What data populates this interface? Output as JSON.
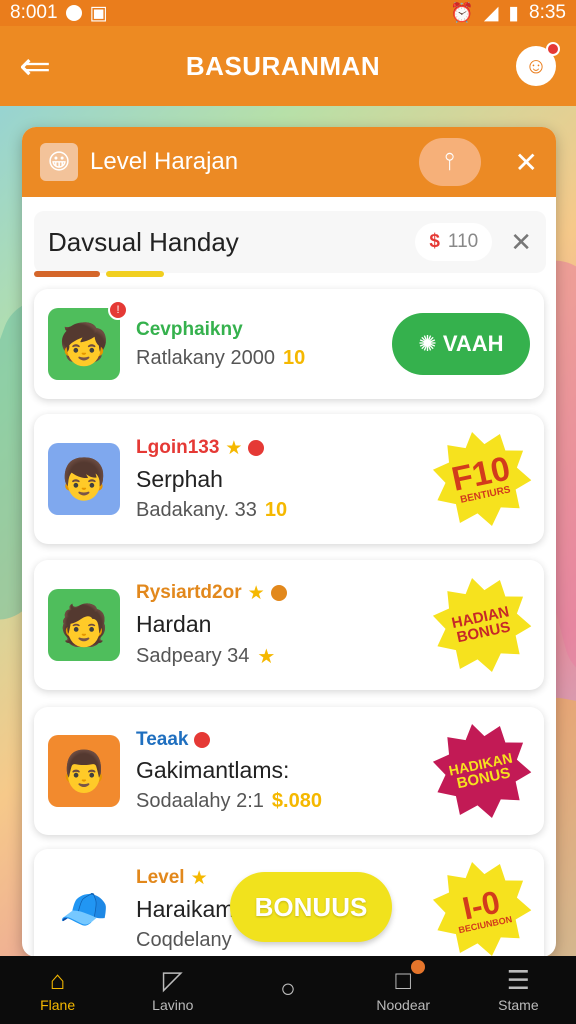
{
  "status": {
    "time_left": "8:001",
    "time_right": "8:35"
  },
  "appbar": {
    "title": "BASURANMAN"
  },
  "modal": {
    "title": "Level Harajan",
    "sub_title": "Davsual Handay",
    "pill_currency": "$",
    "pill_value": "110"
  },
  "cards": [
    {
      "tag": "Cevphaikny",
      "tag_color": "#35b14d",
      "name": "",
      "meta": "Ratlakany 2000",
      "coin": "10",
      "action": "VAAH",
      "burst": ""
    },
    {
      "tag": "Lgoin133",
      "tag_color": "#e53935",
      "name": "Serphah",
      "meta": "Badakany. 33",
      "coin": "10",
      "burst_big": "F10",
      "burst_small": "BENTIURS"
    },
    {
      "tag": "Rysiartd2or",
      "tag_color": "#e2881c",
      "name": "Hardan",
      "meta": "Sadpeary 34",
      "burst_big": "HADIAN",
      "burst_small": "BONUS"
    },
    {
      "tag": "Teaak",
      "tag_color": "#1f6fbf",
      "name": "Gakimantlams:",
      "meta": "Sodaalahy 2:1",
      "coin": "$.080",
      "burst_big": "HADIKAN",
      "burst_small": "BONUS"
    },
    {
      "tag": "Level",
      "tag_color": "#e2881c",
      "name": "Haraikam",
      "meta": "Coqdelany",
      "burst_big": "I-0",
      "burst_small": "BECIUNBON"
    }
  ],
  "bonus_button": "BONUUS",
  "nav": [
    {
      "label": "Flane",
      "icon": "home-icon"
    },
    {
      "label": "Lavino",
      "icon": "chat-icon"
    },
    {
      "label": "",
      "icon": "circle-icon"
    },
    {
      "label": "Noodear",
      "icon": "square-icon"
    },
    {
      "label": "Stame",
      "icon": "menu-icon"
    }
  ],
  "colors": {
    "accent": "#ed8a22",
    "green": "#35b14d",
    "yellow": "#f1e21d"
  }
}
